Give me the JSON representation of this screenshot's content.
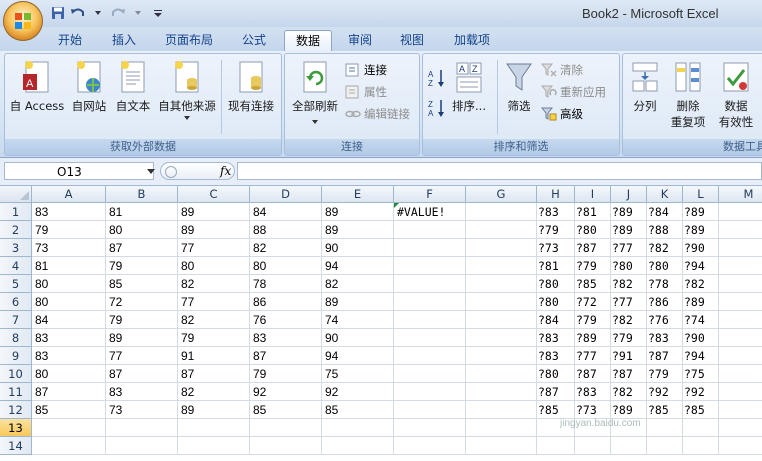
{
  "app": {
    "title": "Book2 - Microsoft Excel"
  },
  "tabs": [
    {
      "label": "开始"
    },
    {
      "label": "插入"
    },
    {
      "label": "页面布局"
    },
    {
      "label": "公式"
    },
    {
      "label": "数据"
    },
    {
      "label": "审阅"
    },
    {
      "label": "视图"
    },
    {
      "label": "加载项"
    }
  ],
  "active_tab": "数据",
  "ribbon": {
    "group_external": {
      "label": "获取外部数据",
      "access": "自 Access",
      "web": "自网站",
      "text": "自文本",
      "other": "自其他来源",
      "existing": "现有连接"
    },
    "group_connections": {
      "label": "连接",
      "refresh_all": "全部刷新",
      "connections": "连接",
      "properties": "属性",
      "edit_links": "编辑链接"
    },
    "group_sort": {
      "label": "排序和筛选",
      "sort": "排序...",
      "filter": "筛选",
      "clear": "清除",
      "reapply": "重新应用",
      "advanced": "高级"
    },
    "group_tools": {
      "label": "数据工具",
      "text_to_columns": "分列",
      "remove_dup_line1": "删除",
      "remove_dup_line2": "重复项",
      "validation_line1": "数据",
      "validation_line2": "有效性"
    }
  },
  "formula_bar": {
    "name_box": "O13",
    "fx": "fx",
    "formula": ""
  },
  "sheet": {
    "columns": [
      "A",
      "B",
      "C",
      "D",
      "E",
      "F",
      "G",
      "H",
      "I",
      "J",
      "K",
      "L",
      "M"
    ],
    "rows": [
      "1",
      "2",
      "3",
      "4",
      "5",
      "6",
      "7",
      "8",
      "9",
      "10",
      "11",
      "12",
      "13",
      "14"
    ],
    "selected_row": "13",
    "cells": [
      [
        "83",
        "81",
        "89",
        "84",
        "89",
        "#VALUE!",
        "",
        "?83",
        "?81",
        "?89",
        "?84",
        "?89",
        ""
      ],
      [
        "79",
        "80",
        "89",
        "88",
        "89",
        "",
        "",
        "?79",
        "?80",
        "?89",
        "?88",
        "?89",
        ""
      ],
      [
        "73",
        "87",
        "77",
        "82",
        "90",
        "",
        "",
        "?73",
        "?87",
        "?77",
        "?82",
        "?90",
        ""
      ],
      [
        "81",
        "79",
        "80",
        "80",
        "94",
        "",
        "",
        "?81",
        "?79",
        "?80",
        "?80",
        "?94",
        ""
      ],
      [
        "80",
        "85",
        "82",
        "78",
        "82",
        "",
        "",
        "?80",
        "?85",
        "?82",
        "?78",
        "?82",
        ""
      ],
      [
        "80",
        "72",
        "77",
        "86",
        "89",
        "",
        "",
        "?80",
        "?72",
        "?77",
        "?86",
        "?89",
        ""
      ],
      [
        "84",
        "79",
        "82",
        "76",
        "74",
        "",
        "",
        "?84",
        "?79",
        "?82",
        "?76",
        "?74",
        ""
      ],
      [
        "83",
        "89",
        "79",
        "83",
        "90",
        "",
        "",
        "?83",
        "?89",
        "?79",
        "?83",
        "?90",
        ""
      ],
      [
        "83",
        "77",
        "91",
        "87",
        "94",
        "",
        "",
        "?83",
        "?77",
        "?91",
        "?87",
        "?94",
        ""
      ],
      [
        "80",
        "87",
        "87",
        "79",
        "75",
        "",
        "",
        "?80",
        "?87",
        "?87",
        "?79",
        "?75",
        ""
      ],
      [
        "87",
        "83",
        "82",
        "92",
        "92",
        "",
        "",
        "?87",
        "?83",
        "?82",
        "?92",
        "?92",
        ""
      ],
      [
        "85",
        "73",
        "89",
        "85",
        "85",
        "",
        "",
        "?85",
        "?73",
        "?89",
        "?85",
        "?85",
        ""
      ],
      [
        "",
        "",
        "",
        "",
        "",
        "",
        "",
        "",
        "",
        "",
        "",
        "",
        ""
      ],
      [
        "",
        "",
        "",
        "",
        "",
        "",
        "",
        "",
        "",
        "",
        "",
        "",
        ""
      ]
    ]
  },
  "watermark": "jingyan.baidu.com",
  "colors": {
    "accent": "#15428b",
    "selected_row_header": "#f7c85b",
    "error_marker": "#1e8a3a"
  }
}
